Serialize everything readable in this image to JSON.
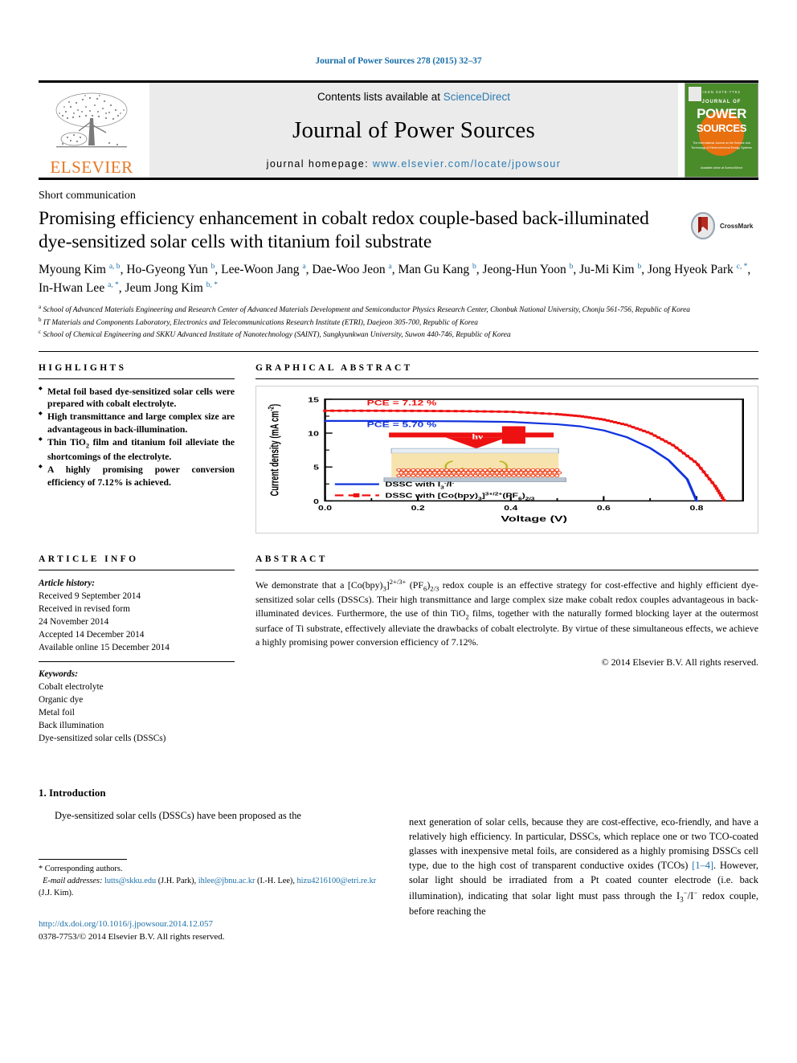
{
  "running_head": "Journal of Power Sources 278 (2015) 32–37",
  "masthead": {
    "contents_prefix": "Contents lists available at ",
    "sciencedirect": "ScienceDirect",
    "journal_title": "Journal of Power Sources",
    "homepage_label": "journal homepage:",
    "homepage_url": "www.elsevier.com/locate/jpowsour",
    "elsevier_word": "ELSEVIER",
    "cover": {
      "kicker": "ISSN 0378-7753",
      "journal_of": "JOURNAL OF",
      "power": "POWER",
      "sources": "SOURCES",
      "subtitle": "The International Journal on the Science and Technology of Electrochemical Energy Systems",
      "footer": "Available online at\nScienceDirect"
    }
  },
  "article": {
    "type": "Short communication",
    "title": "Promising efficiency enhancement in cobalt redox couple-based back-illuminated dye-sensitized solar cells with titanium foil substrate",
    "crossmark_label": "CrossMark",
    "authors": [
      {
        "name": "Myoung Kim",
        "marks": "a, b",
        "sep": ", "
      },
      {
        "name": "Ho-Gyeong Yun",
        "marks": "b",
        "sep": ", "
      },
      {
        "name": "Lee-Woon Jang",
        "marks": "a",
        "sep": ", "
      },
      {
        "name": "Dae-Woo Jeon",
        "marks": "a",
        "sep": ", "
      },
      {
        "name": "Man Gu Kang",
        "marks": "b",
        "sep": ", "
      },
      {
        "name": "Jeong-Hun Yoon",
        "marks": "b",
        "sep": ", "
      },
      {
        "name": "Ju-Mi Kim",
        "marks": "b",
        "sep": ", "
      },
      {
        "name": "Jong Hyeok Park",
        "marks": "c, *",
        "sep": ", "
      },
      {
        "name": "In-Hwan Lee",
        "marks": "a, *",
        "sep": ", "
      },
      {
        "name": "Jeum Jong Kim",
        "marks": "b, *",
        "sep": ""
      }
    ],
    "affiliations": [
      {
        "mark": "a",
        "text": "School of Advanced Materials Engineering and Research Center of Advanced Materials Development and Semiconductor Physics Research Center, Chonbuk National University, Chonju 561-756, Republic of Korea"
      },
      {
        "mark": "b",
        "text": "IT Materials and Components Laboratory, Electronics and Telecommunications Research Institute (ETRI), Daejeon 305-700, Republic of Korea"
      },
      {
        "mark": "c",
        "text": "School of Chemical Engineering and SKKU Advanced Institute of Nanotechnology (SAINT), Sungkyunkwan University, Suwon 440-746, Republic of Korea"
      }
    ]
  },
  "highlights": {
    "heading": "HIGHLIGHTS",
    "items": [
      "Metal foil based dye-sensitized solar cells were prepared with cobalt electrolyte.",
      "High transmittance and large complex size are advantageous in back-illumination.",
      "Thin TiO2 film and titanium foil alleviate the shortcomings of the electrolyte.",
      "A highly promising power conversion efficiency of 7.12% is achieved."
    ]
  },
  "graphical_abstract": {
    "heading": "GRAPHICAL ABSTRACT"
  },
  "chart_data": {
    "type": "line",
    "title": "",
    "xlabel": "Voltage (V)",
    "ylabel": "Current density (mA cm−2)",
    "xlim": [
      0.0,
      0.9
    ],
    "ylim": [
      0,
      15
    ],
    "xticks": [
      "0.0",
      "0.2",
      "0.4",
      "0.6",
      "0.8"
    ],
    "yticks": [
      "0",
      "5",
      "10",
      "15"
    ],
    "grid": false,
    "annotations": [
      {
        "text": "PCE = 7.12 %",
        "color": "#ee1111",
        "x": 0.09,
        "y": 14.1
      },
      {
        "text": "PCE = 5.70 %",
        "color": "#1133dd",
        "x": 0.09,
        "y": 10.9
      }
    ],
    "legend_position": "inside-bottom-left",
    "series": [
      {
        "name": "DSSC with I3−/I−",
        "color": "#1133dd",
        "marker": "none",
        "x": [
          0.0,
          0.1,
          0.2,
          0.3,
          0.4,
          0.5,
          0.55,
          0.6,
          0.65,
          0.7,
          0.74,
          0.78,
          0.8
        ],
        "y": [
          11.8,
          11.8,
          11.78,
          11.74,
          11.65,
          11.3,
          11.0,
          10.4,
          9.4,
          7.8,
          6.0,
          3.2,
          0.0
        ]
      },
      {
        "name": "DSSC with [Co(bpy)3]3+/2+(PF6)2/3",
        "color": "#ee1111",
        "marker": "square",
        "x": [
          0.0,
          0.1,
          0.2,
          0.3,
          0.4,
          0.5,
          0.55,
          0.6,
          0.65,
          0.7,
          0.75,
          0.8,
          0.84,
          0.86
        ],
        "y": [
          13.3,
          13.3,
          13.28,
          13.24,
          13.15,
          12.8,
          12.5,
          12.0,
          11.2,
          10.0,
          8.2,
          5.6,
          2.2,
          0.0
        ]
      }
    ],
    "inset": {
      "label": "hν",
      "description": "back-illuminated DSSC device schematic"
    }
  },
  "article_info": {
    "heading": "ARTICLE INFO",
    "history_label": "Article history:",
    "history": [
      "Received 9 September 2014",
      "Received in revised form",
      "24 November 2014",
      "Accepted 14 December 2014",
      "Available online 15 December 2014"
    ],
    "keywords_label": "Keywords:",
    "keywords": [
      "Cobalt electrolyte",
      "Organic dye",
      "Metal foil",
      "Back illumination",
      "Dye-sensitized solar cells (DSSCs)"
    ]
  },
  "abstract": {
    "heading": "ABSTRACT",
    "text_parts": {
      "p1": "We demonstrate that a [Co(bpy)",
      "p2": "3",
      "p3": "]",
      "p4": "2+/3+",
      "p5": " (PF",
      "p6": "6",
      "p7": ")",
      "p8": "2/3",
      "p9": " redox couple is an effective strategy for cost-effective and highly efficient dye-sensitized solar cells (DSSCs). Their high transmittance and large complex size make cobalt redox couples advantageous in back-illuminated devices. Furthermore, the use of thin TiO",
      "p10": "2",
      "p11": " films, together with the naturally formed blocking layer at the outermost surface of Ti substrate, effectively alleviate the drawbacks of cobalt electrolyte. By virtue of these simultaneous effects, we achieve a highly promising power conversion efficiency of 7.12%."
    },
    "copyright": "© 2014 Elsevier B.V. All rights reserved."
  },
  "body": {
    "section_number_title": "1. Introduction",
    "left_para": "Dye-sensitized solar cells (DSSCs) have been proposed as the",
    "right_para_1": "next generation of solar cells, because they are cost-effective, eco-friendly, and have a relatively high efficiency. In particular, DSSCs, which replace one or two TCO-coated glasses with inexpensive metal foils, are considered as a highly promising DSSCs cell type, due to the high cost of transparent conductive oxides (TCOs) ",
    "right_ref": "[1–4]",
    "right_para_2": ". However, solar light should be irradiated from a Pt coated counter electrode (i.e. back illumination), indicating that solar light must pass through the I",
    "right_sub": "3",
    "right_sup": "−",
    "right_para_3": "/I",
    "right_sup2": "−",
    "right_para_4": " redox couple, before reaching the"
  },
  "footnote": {
    "star": "*",
    "corresponding": "Corresponding authors.",
    "email_label": "E-mail addresses:",
    "emails": [
      {
        "address": "lutts@skku.edu",
        "who": "(J.H. Park)"
      },
      {
        "address": "ihlee@jbnu.ac.kr",
        "who": "(I.-H. Lee)"
      },
      {
        "address": "hizu4216100@etri.re.kr",
        "who": "(J.J. Kim)"
      }
    ]
  },
  "doi_block": {
    "doi_url": "http://dx.doi.org/10.1016/j.jpowsour.2014.12.057",
    "issn_line": "0378-7753/© 2014 Elsevier B.V. All rights reserved."
  }
}
